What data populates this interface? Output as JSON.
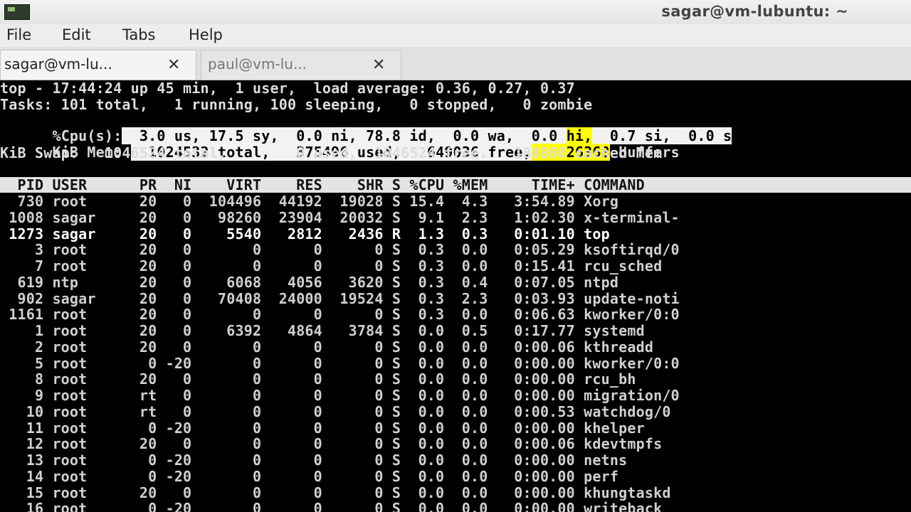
{
  "window": {
    "title": "sagar@vm-lubuntu: ~",
    "icon": "terminal-icon"
  },
  "menu": [
    "File",
    "Edit",
    "Tabs",
    "Help"
  ],
  "tabs": [
    {
      "label": "sagar@vm-lu...",
      "close": "✕",
      "active": true
    },
    {
      "label": "paul@vm-lu...",
      "close": "✕",
      "active": false
    }
  ],
  "top": {
    "summary": "top - 17:44:24 up 45 min,  1 user,  load average: 0.36, 0.27, 0.37",
    "tasks": "Tasks: 101 total,   1 running, 100 sleeping,   0 stopped,   0 zombie",
    "cpu": {
      "label": "%Cpu(s):",
      "us": "  3.0 us,",
      "sy": " 17.5 sy,",
      "ni": "  0.0 ni,",
      "id": " 78.8 id,",
      "wa": "  0.0 wa,",
      "hi_val": "  0.0 ",
      "hi": "hi,",
      "si": "  0.7 si,",
      "st": "  0.0 s"
    },
    "mem": {
      "label": "KiB Mem: ",
      "total": "  1024532 total,",
      "used": "   375496 used,",
      "free": "   649036 free,",
      "buffers_val": "    26368",
      "buffers": " buffers"
    },
    "swap": "KiB Swap:   1046524 total,        0 used,  1046524 free.   188880 cached Mem",
    "header": "  PID USER      PR  NI    VIRT    RES    SHR S %CPU %MEM     TIME+ COMMAND",
    "processes": [
      {
        "text": "  730 root      20   0  104496  44192  19028 S 15.4  4.3   3:54.89 Xorg",
        "bold": false
      },
      {
        "text": " 1008 sagar     20   0   98260  23904  20032 S  9.1  2.3   1:02.30 x-terminal-",
        "bold": false
      },
      {
        "text": " 1273 sagar     20   0    5540   2812   2436 R  1.3  0.3   0:01.10 top",
        "bold": true
      },
      {
        "text": "    3 root      20   0       0      0      0 S  0.3  0.0   0:05.29 ksoftirqd/0",
        "bold": false
      },
      {
        "text": "    7 root      20   0       0      0      0 S  0.3  0.0   0:15.41 rcu_sched",
        "bold": false
      },
      {
        "text": "  619 ntp       20   0    6068   4056   3620 S  0.3  0.4   0:07.05 ntpd",
        "bold": false
      },
      {
        "text": "  902 sagar     20   0   70408  24000  19524 S  0.3  2.3   0:03.93 update-noti",
        "bold": false
      },
      {
        "text": " 1161 root      20   0       0      0      0 S  0.3  0.0   0:06.63 kworker/0:0",
        "bold": false
      },
      {
        "text": "    1 root      20   0    6392   4864   3784 S  0.0  0.5   0:17.77 systemd",
        "bold": false
      },
      {
        "text": "    2 root      20   0       0      0      0 S  0.0  0.0   0:00.06 kthreadd",
        "bold": false
      },
      {
        "text": "    5 root       0 -20       0      0      0 S  0.0  0.0   0:00.00 kworker/0:0",
        "bold": false
      },
      {
        "text": "    8 root      20   0       0      0      0 S  0.0  0.0   0:00.00 rcu_bh",
        "bold": false
      },
      {
        "text": "    9 root      rt   0       0      0      0 S  0.0  0.0   0:00.00 migration/0",
        "bold": false
      },
      {
        "text": "   10 root      rt   0       0      0      0 S  0.0  0.0   0:00.53 watchdog/0",
        "bold": false
      },
      {
        "text": "   11 root       0 -20       0      0      0 S  0.0  0.0   0:00.00 khelper",
        "bold": false
      },
      {
        "text": "   12 root      20   0       0      0      0 S  0.0  0.0   0:00.06 kdevtmpfs",
        "bold": false
      },
      {
        "text": "   13 root       0 -20       0      0      0 S  0.0  0.0   0:00.00 netns",
        "bold": false
      },
      {
        "text": "   14 root       0 -20       0      0      0 S  0.0  0.0   0:00.00 perf",
        "bold": false
      },
      {
        "text": "   15 root      20   0       0      0      0 S  0.0  0.0   0:00.00 khungtaskd",
        "bold": false
      },
      {
        "text": "   16 root       0 -20       0      0      0 S  0.0  0.0   0:00.00 writeback",
        "bold": false
      }
    ]
  },
  "colors": {
    "terminal_bg": "#000000",
    "terminal_fg": "#dcdcdc",
    "highlight_white": "#f2f2f2",
    "highlight_yellow": "#ffff00"
  }
}
